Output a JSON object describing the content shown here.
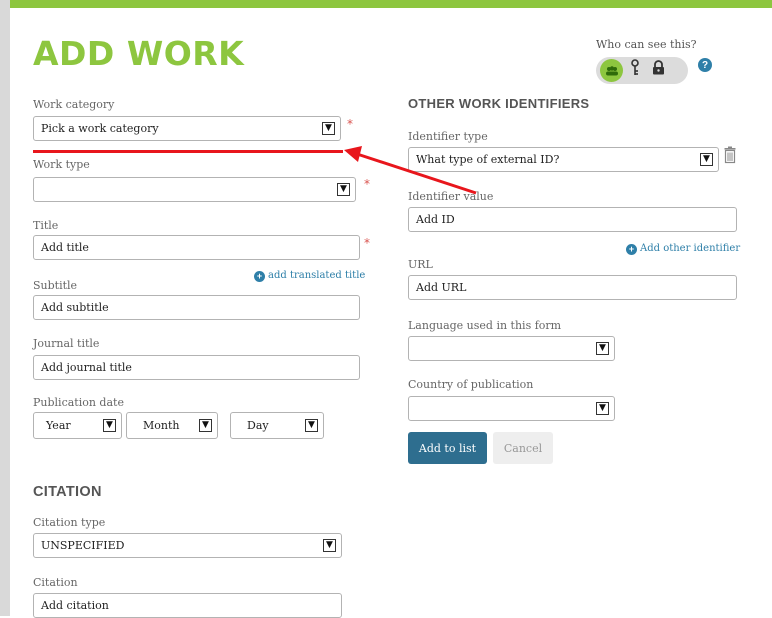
{
  "header": {
    "title": "ADD WORK",
    "who_can_see": "Who can see this?",
    "help_symbol": "?",
    "visibility_icons": [
      "everyone-icon",
      "trusted-parties-icon",
      "private-icon"
    ]
  },
  "work": {
    "category_label": "Work category",
    "category_value": "Pick a work category",
    "type_label": "Work type",
    "type_value": "",
    "title_label": "Title",
    "title_placeholder": "Add title",
    "translated_link": "add translated title",
    "subtitle_label": "Subtitle",
    "subtitle_placeholder": "Add subtitle",
    "journal_label": "Journal title",
    "journal_placeholder": "Add journal title",
    "date_label": "Publication date",
    "year": "Year",
    "month": "Month",
    "day": "Day",
    "required_mark": "*"
  },
  "citation": {
    "heading": "CITATION",
    "type_label": "Citation type",
    "type_value": "UNSPECIFIED",
    "citation_label": "Citation",
    "citation_placeholder": "Add citation"
  },
  "identifiers": {
    "heading": "OTHER WORK IDENTIFIERS",
    "type_label": "Identifier type",
    "type_value": "What type of external ID?",
    "value_label": "Identifier value",
    "value_placeholder": "Add ID",
    "add_other": "Add other identifier",
    "url_label": "URL",
    "url_placeholder": "Add URL",
    "language_label": "Language used in this form",
    "language_value": "",
    "country_label": "Country of publication",
    "country_value": ""
  },
  "actions": {
    "add_to_list": "Add to list",
    "cancel": "Cancel"
  },
  "colors": {
    "brand_green": "#8dc63f",
    "link_blue": "#2e7fa8",
    "primary_button": "#2e6e8f",
    "annotation_red": "#e8161c"
  }
}
